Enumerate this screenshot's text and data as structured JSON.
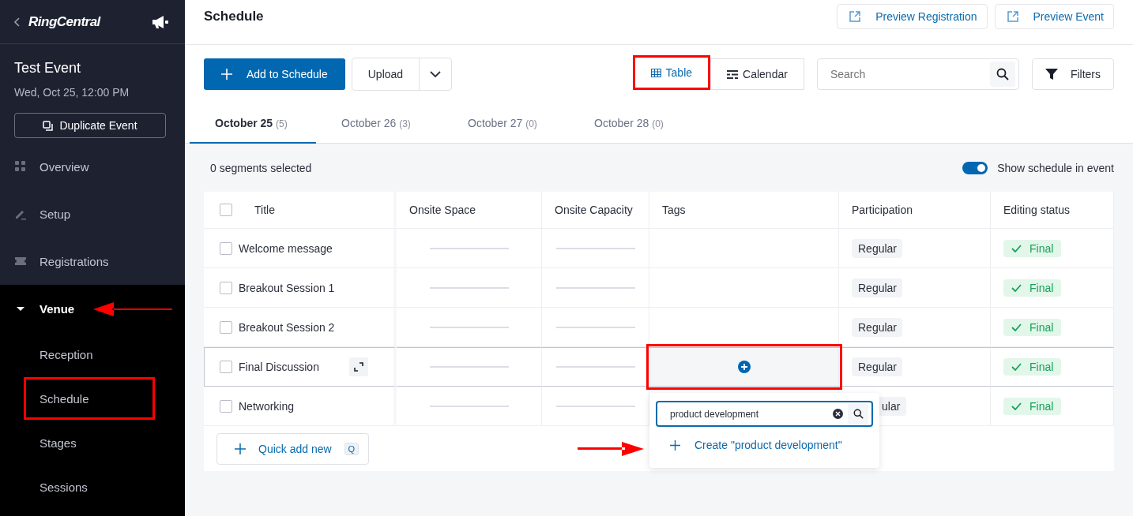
{
  "sidebar": {
    "brand": "RingCentral",
    "event_title": "Test Event",
    "event_date": "Wed, Oct 25, 12:00 PM",
    "duplicate_button": "Duplicate Event",
    "items": [
      {
        "label": "Overview",
        "expanded": false
      },
      {
        "label": "Setup",
        "expanded": false
      },
      {
        "label": "Registrations",
        "expanded": false
      },
      {
        "label": "Venue",
        "expanded": true,
        "arrow": true,
        "children": [
          {
            "label": "Reception",
            "highlighted": false
          },
          {
            "label": "Schedule",
            "highlighted": true
          },
          {
            "label": "Stages",
            "highlighted": false
          },
          {
            "label": "Sessions",
            "highlighted": false
          }
        ]
      }
    ]
  },
  "header": {
    "title": "Schedule",
    "actions": [
      "Preview Registration",
      "Preview Event"
    ]
  },
  "toolbar": {
    "add_button": "Add to Schedule",
    "upload_button": "Upload",
    "views": [
      {
        "label": "Table",
        "selected": true,
        "highlighted": true
      },
      {
        "label": "Calendar",
        "selected": false,
        "highlighted": false
      }
    ],
    "search": {
      "placeholder": "Search"
    },
    "filters_button": "Filters"
  },
  "tabs": [
    {
      "label": "October 25",
      "count": "(5)",
      "selected": true
    },
    {
      "label": "October 26",
      "count": "(3)",
      "selected": false
    },
    {
      "label": "October 27",
      "count": "(0)",
      "selected": false
    },
    {
      "label": "October 28",
      "count": "(0)",
      "selected": false
    }
  ],
  "selection_summary": "0 segments selected",
  "show_schedule_toggle": {
    "label": "Show schedule in event",
    "on": true
  },
  "table": {
    "header_checked": false,
    "columns": [
      "Title",
      "Onsite Space",
      "Onsite Capacity",
      "Tags",
      "Participation",
      "Editing status"
    ],
    "rows": [
      {
        "title": "Welcome message",
        "checked": false,
        "hovered": false,
        "tag_editing": false,
        "participation": "Regular",
        "participation_clipped": false,
        "status": "Final"
      },
      {
        "title": "Breakout Session 1",
        "checked": false,
        "hovered": false,
        "tag_editing": false,
        "participation": "Regular",
        "participation_clipped": false,
        "status": "Final"
      },
      {
        "title": "Breakout Session 2",
        "checked": false,
        "hovered": false,
        "tag_editing": false,
        "participation": "Regular",
        "participation_clipped": false,
        "status": "Final"
      },
      {
        "title": "Final Discussion",
        "checked": false,
        "hovered": true,
        "tag_editing": true,
        "participation": "Regular",
        "participation_clipped": false,
        "status": "Final"
      },
      {
        "title": "Networking",
        "checked": false,
        "hovered": false,
        "tag_editing": false,
        "participation": "ular",
        "participation_clipped": true,
        "status": "Final"
      }
    ]
  },
  "quick_add": {
    "label": "Quick add new",
    "shortcut": "Q"
  },
  "tag_picker": {
    "value": "product development",
    "create_option": "Create \"product development\"",
    "arrow": true
  }
}
